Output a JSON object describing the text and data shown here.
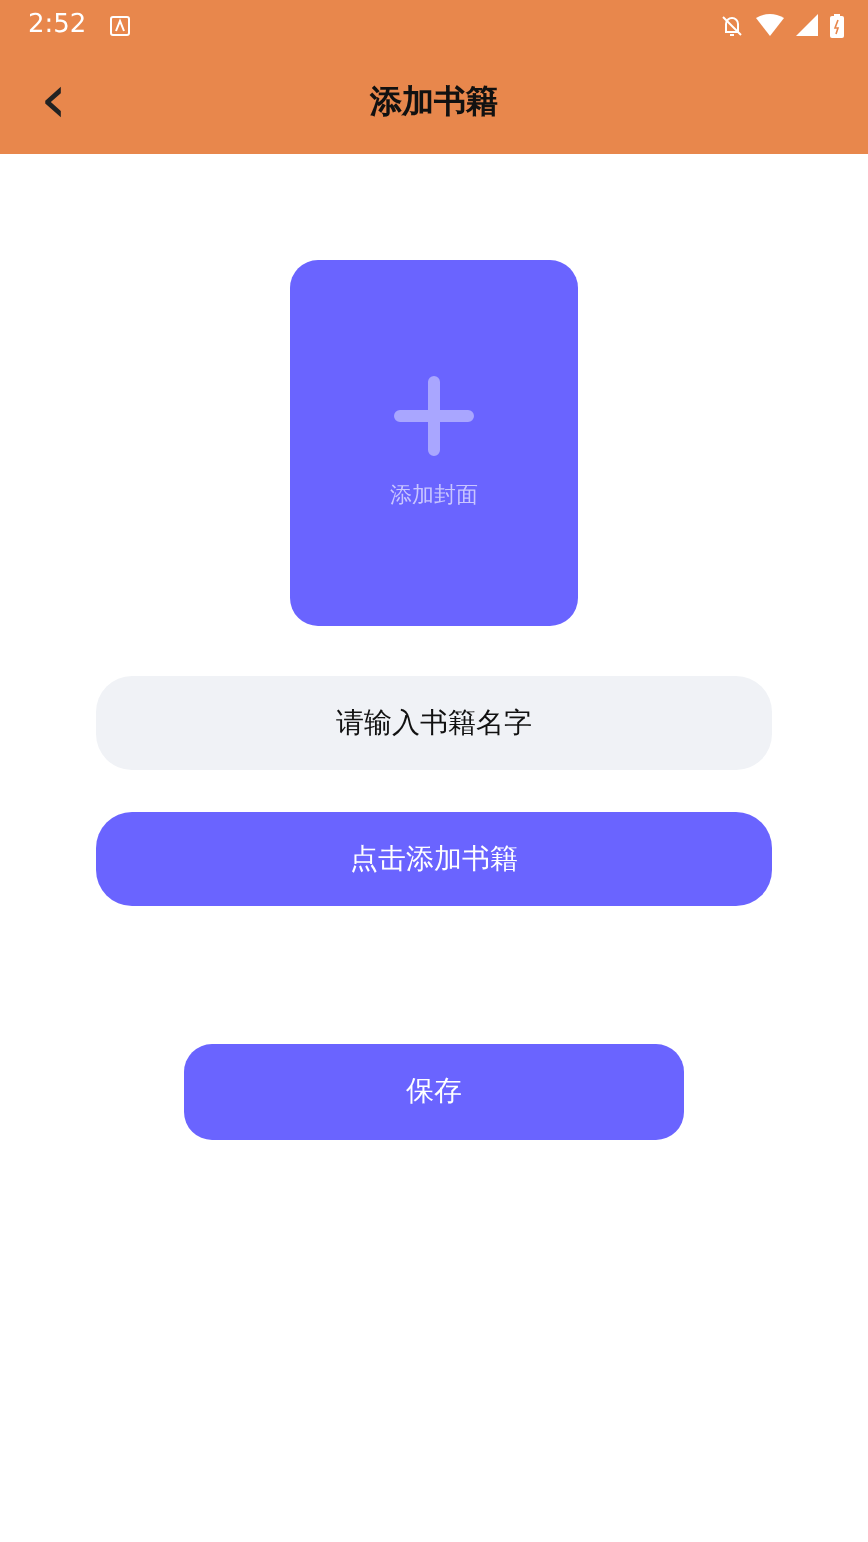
{
  "status_bar": {
    "time": "2:52"
  },
  "toolbar": {
    "back": "‹",
    "title": "添加书籍"
  },
  "cover": {
    "label": "添加封面"
  },
  "name_field": {
    "placeholder": "请输入书籍名字"
  },
  "add_button": "点击添加书籍",
  "save_button": "保存"
}
